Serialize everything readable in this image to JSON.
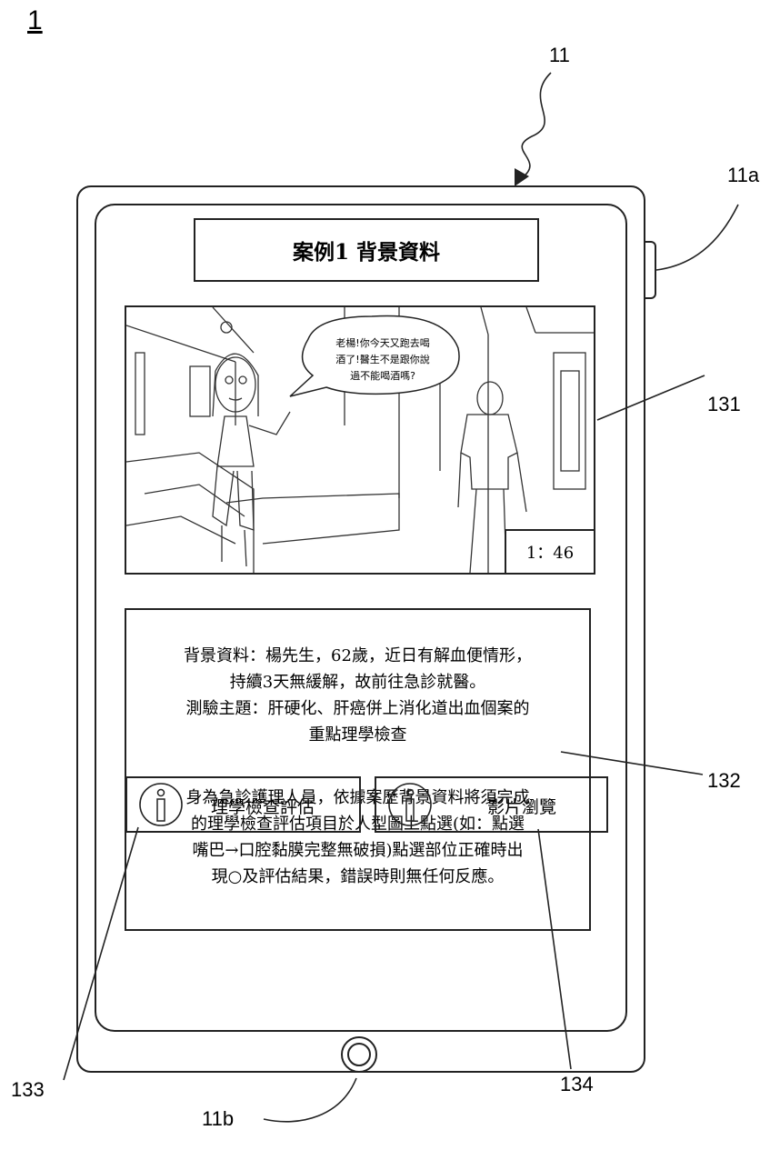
{
  "figure_number": "1",
  "reference_labels": {
    "device": "11",
    "side_button": "11a",
    "home_button": "11b",
    "video_area": "131",
    "text_area": "132",
    "left_button": "133",
    "right_button": "134"
  },
  "screen": {
    "title": "案例1  背景資料",
    "video": {
      "speech_bubble": [
        "老楊!你今天又跑去喝",
        "酒了!醫生不是跟你說",
        "過不能喝酒嗎?"
      ],
      "timestamp": "1：46"
    },
    "description": {
      "paragraph1": [
        "背景資料：楊先生，62歲，近日有解血便情形，",
        "持續3天無緩解，故前往急診就醫。",
        "測驗主題：肝硬化、肝癌併上消化道出血個案的",
        "重點理學檢查"
      ],
      "paragraph2": [
        "身為急診護理人員，依據案歷背景資料將須完成",
        "的理學檢查評估項目於人型圖上點選(如：點選",
        "嘴巴→口腔黏膜完整無破損)點選部位正確時出",
        "現○及評估結果，錯誤時則無任何反應。"
      ]
    },
    "buttons": {
      "left_label": "理學檢查評估",
      "right_label": "影片瀏覽"
    }
  },
  "colors": {
    "line": "#222222",
    "background": "#ffffff"
  }
}
